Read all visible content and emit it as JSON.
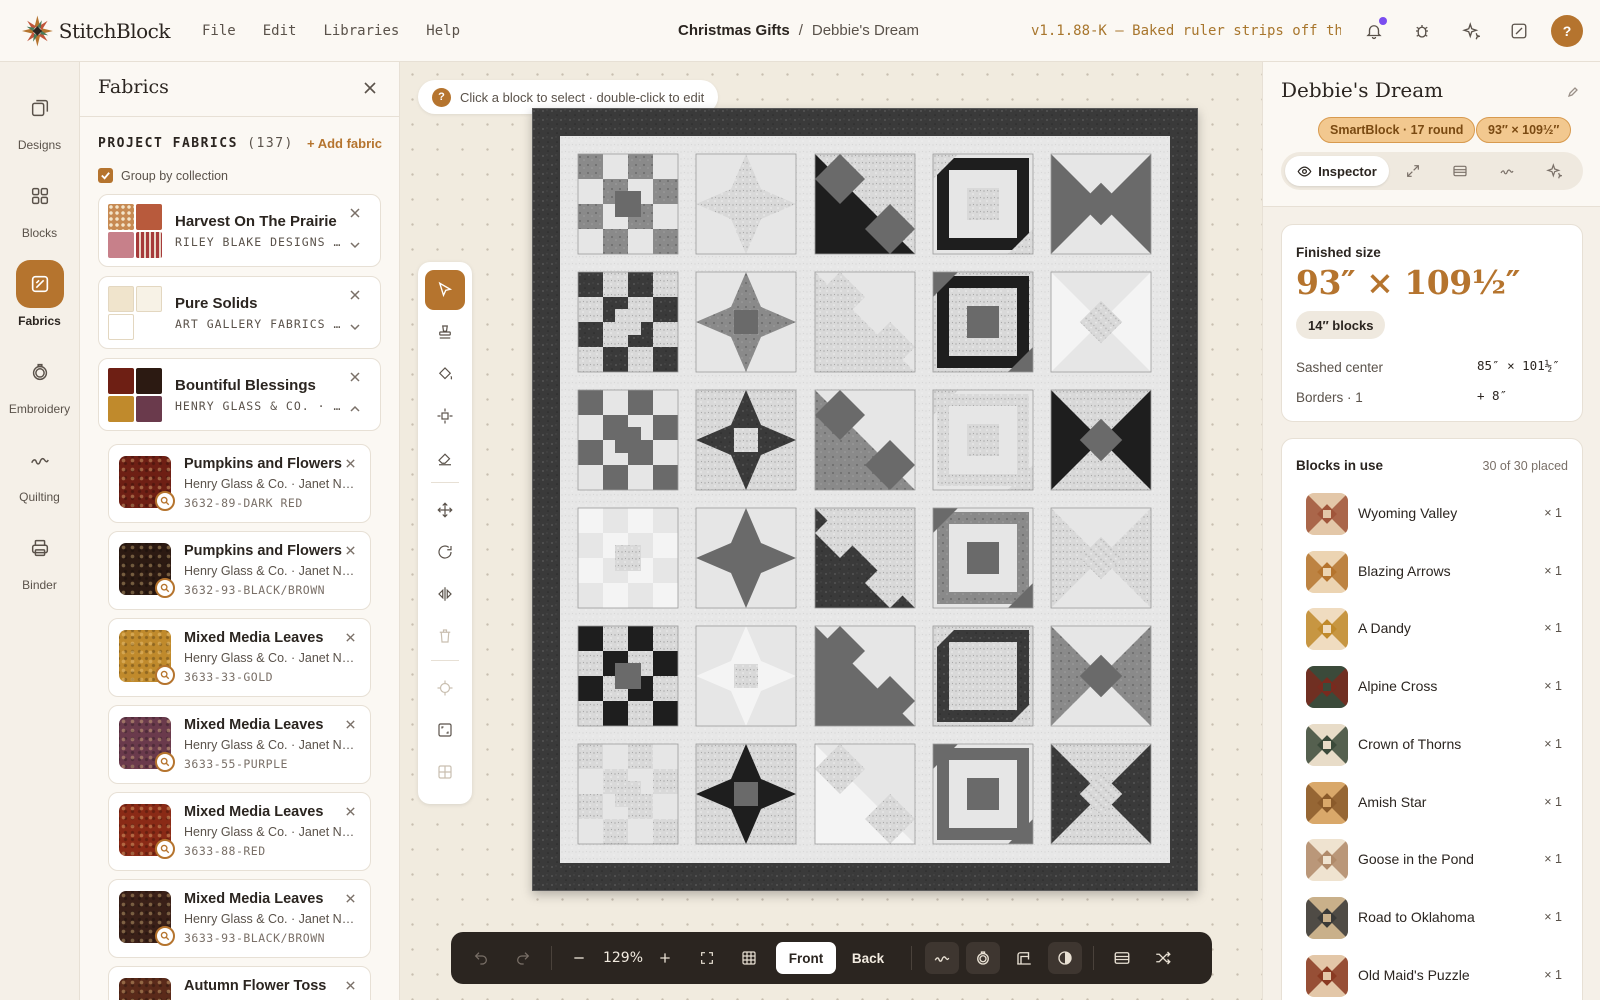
{
  "app": {
    "name": "StitchBlock"
  },
  "menu": [
    "File",
    "Edit",
    "Libraries",
    "Help"
  ],
  "breadcrumb": {
    "project": "Christmas Gifts",
    "separator": "/",
    "design": "Debbie's Dream"
  },
  "version": "v1.1.88-K — Baked ruler strips off th…",
  "user": {
    "avatar_label": "?"
  },
  "colors": {
    "accent": "#b5742e",
    "notification_dot": "#7a4df0",
    "pill_bg": "#f2c88f"
  },
  "left_nav": [
    {
      "label": "Designs",
      "icon": "layers-icon"
    },
    {
      "label": "Blocks",
      "icon": "grid-icon"
    },
    {
      "label": "Fabrics",
      "icon": "fabric-icon",
      "active": true
    },
    {
      "label": "Embroidery",
      "icon": "hoop-icon"
    },
    {
      "label": "Quilting",
      "icon": "squiggle-icon"
    },
    {
      "label": "Binder",
      "icon": "printer-icon"
    }
  ],
  "fabrics_panel": {
    "title": "Fabrics",
    "section_label": "PROJECT FABRICS",
    "count": "(137)",
    "add_label": "+ Add fabric",
    "group_by_label": "Group by collection",
    "group_by_checked": true,
    "collections": [
      {
        "name": "Harvest On The Prairie",
        "maker": "RILEY BLAKE DESIGNS …",
        "expanded": false
      },
      {
        "name": "Pure Solids",
        "maker": "ART GALLERY FABRICS …",
        "expanded": false
      },
      {
        "name": "Bountiful Blessings",
        "maker": "HENRY GLASS & CO. · …",
        "expanded": true
      }
    ],
    "fabrics": [
      {
        "name": "Pumpkins and Flowers",
        "maker": "Henry Glass & Co. · Janet N…",
        "code": "3632-89-DARK RED",
        "color": "#6e1f14"
      },
      {
        "name": "Pumpkins and Flowers",
        "maker": "Henry Glass & Co. · Janet N…",
        "code": "3632-93-BLACK/BROWN",
        "color": "#2c1a12"
      },
      {
        "name": "Mixed Media Leaves",
        "maker": "Henry Glass & Co. · Janet N…",
        "code": "3633-33-GOLD",
        "color": "#c08a2c"
      },
      {
        "name": "Mixed Media Leaves",
        "maker": "Henry Glass & Co. · Janet N…",
        "code": "3633-55-PURPLE",
        "color": "#6a3a4c"
      },
      {
        "name": "Mixed Media Leaves",
        "maker": "Henry Glass & Co. · Janet N…",
        "code": "3633-88-RED",
        "color": "#8a2a16"
      },
      {
        "name": "Mixed Media Leaves",
        "maker": "Henry Glass & Co. · Janet N…",
        "code": "3633-93-BLACK/BROWN",
        "color": "#3a2018"
      },
      {
        "name": "Autumn Flower Toss",
        "maker": "",
        "code": "",
        "color": "#5a2a1a"
      }
    ]
  },
  "canvas": {
    "hint": "Click a block to select · double-click to edit",
    "hint_icon": "?",
    "zoom": "129%",
    "view_front": "Front",
    "view_back": "Back",
    "active_view": "Front"
  },
  "inspector": {
    "title": "Debbie's Dream",
    "pills": [
      "SmartBlock · 17 round",
      "93″ × 109½″"
    ],
    "tab_label": "Inspector",
    "finished_size_label": "Finished size",
    "finished_size": "93″ × 109½″",
    "blocks_badge": "14″ blocks",
    "sashed_center_label": "Sashed center",
    "sashed_center_value": "85″ × 101½″",
    "borders_label": "Borders · 1",
    "borders_value": "+ 8″",
    "blocks_in_use_label": "Blocks in use",
    "blocks_placed": "30 of 30 placed",
    "blocks": [
      {
        "name": "Wyoming Valley",
        "count": "× 1",
        "c1": "#a0553a",
        "c2": "#e3c7a8"
      },
      {
        "name": "Blazing Arrows",
        "count": "× 1",
        "c1": "#b5742e",
        "c2": "#ecd4b2"
      },
      {
        "name": "A Dandy",
        "count": "× 1",
        "c1": "#c08a2c",
        "c2": "#f0dcc0"
      },
      {
        "name": "Alpine Cross",
        "count": "× 1",
        "c1": "#7a2a1e",
        "c2": "#3b4a3a"
      },
      {
        "name": "Crown of Thorns",
        "count": "× 1",
        "c1": "#3b4a3a",
        "c2": "#e8dcc8"
      },
      {
        "name": "Amish Star",
        "count": "× 1",
        "c1": "#8a5a2a",
        "c2": "#d9a86a"
      },
      {
        "name": "Goose in the Pond",
        "count": "× 1",
        "c1": "#b08a6a",
        "c2": "#efe3d0"
      },
      {
        "name": "Road to Oklahoma",
        "count": "× 1",
        "c1": "#3a3a38",
        "c2": "#c9b08a"
      },
      {
        "name": "Old Maid's Puzzle",
        "count": "× 1",
        "c1": "#8a3a22",
        "c2": "#e3c7a8"
      }
    ]
  }
}
